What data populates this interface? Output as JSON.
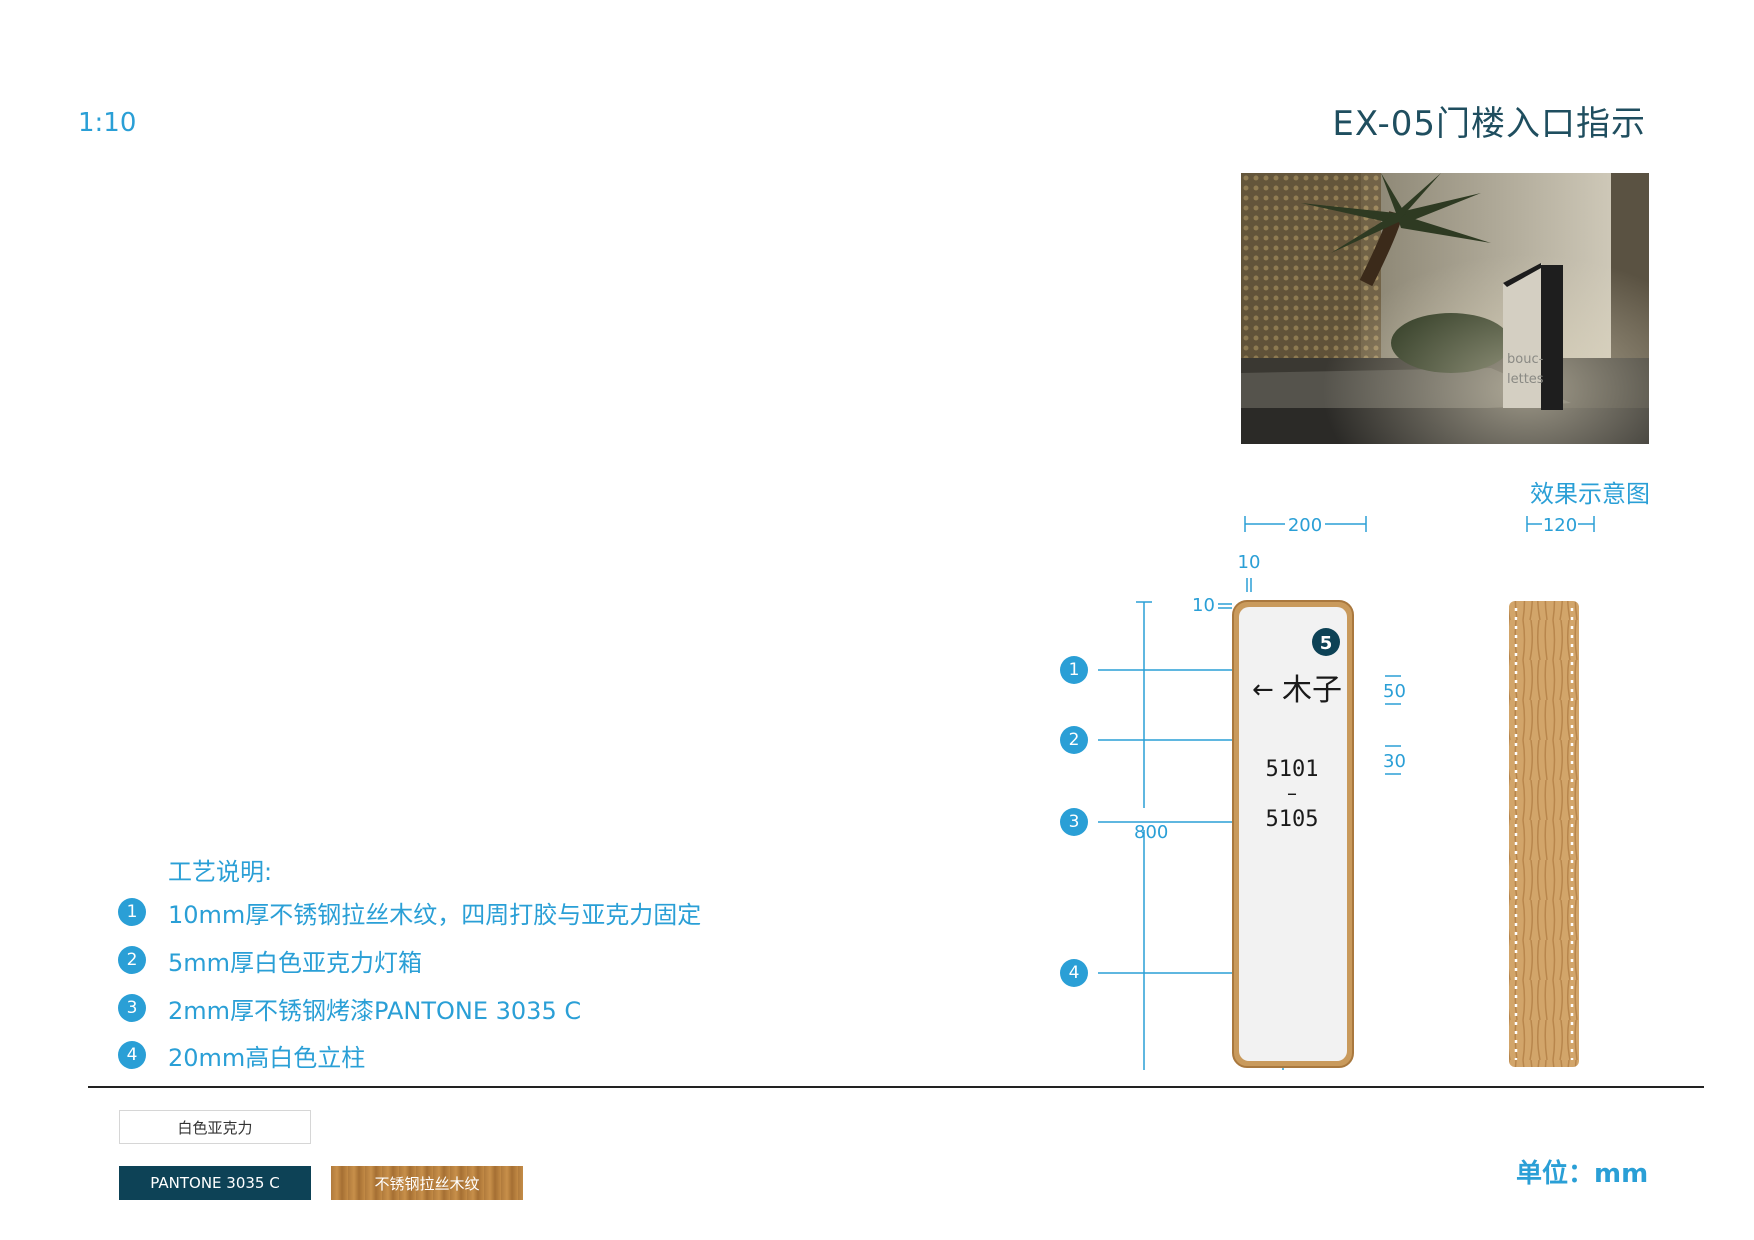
{
  "header": {
    "scale": "1:10",
    "title": "EX-05门楼入口指示"
  },
  "photo": {
    "caption": "效果示意图",
    "sign_text_1": "bouc-",
    "sign_text_2": "lettes"
  },
  "craft": {
    "title": "工艺说明:",
    "notes": [
      {
        "num": "1",
        "text": "10mm厚不锈钢拉丝木纹，四周打胶与亚克力固定"
      },
      {
        "num": "2",
        "text": "5mm厚白色亚克力灯箱"
      },
      {
        "num": "3",
        "text": "2mm厚不锈钢烤漆PANTONE 3035 C"
      },
      {
        "num": "4",
        "text": "20mm高白色立柱"
      }
    ]
  },
  "drawing": {
    "callouts": [
      "1",
      "2",
      "3",
      "4"
    ],
    "badge": "5",
    "sign_arrow": "←",
    "sign_name": "木子",
    "sign_room_start": "5101",
    "sign_dash": "–",
    "sign_room_end": "5105",
    "dims": {
      "front_width": "200",
      "side_width": "120",
      "top_gap": "10",
      "side_gap": "10",
      "height": "800",
      "text_h1": "50",
      "text_h2": "30"
    }
  },
  "materials": {
    "white_acrylic": "白色亚克力",
    "pantone": "PANTONE 3035 C",
    "wood": "不锈钢拉丝木纹"
  },
  "unit": "单位：mm",
  "colors": {
    "accent": "#2a9fd6",
    "pantone": "#0d4256",
    "title": "#1f4e5f",
    "wood": "#c28a45"
  }
}
